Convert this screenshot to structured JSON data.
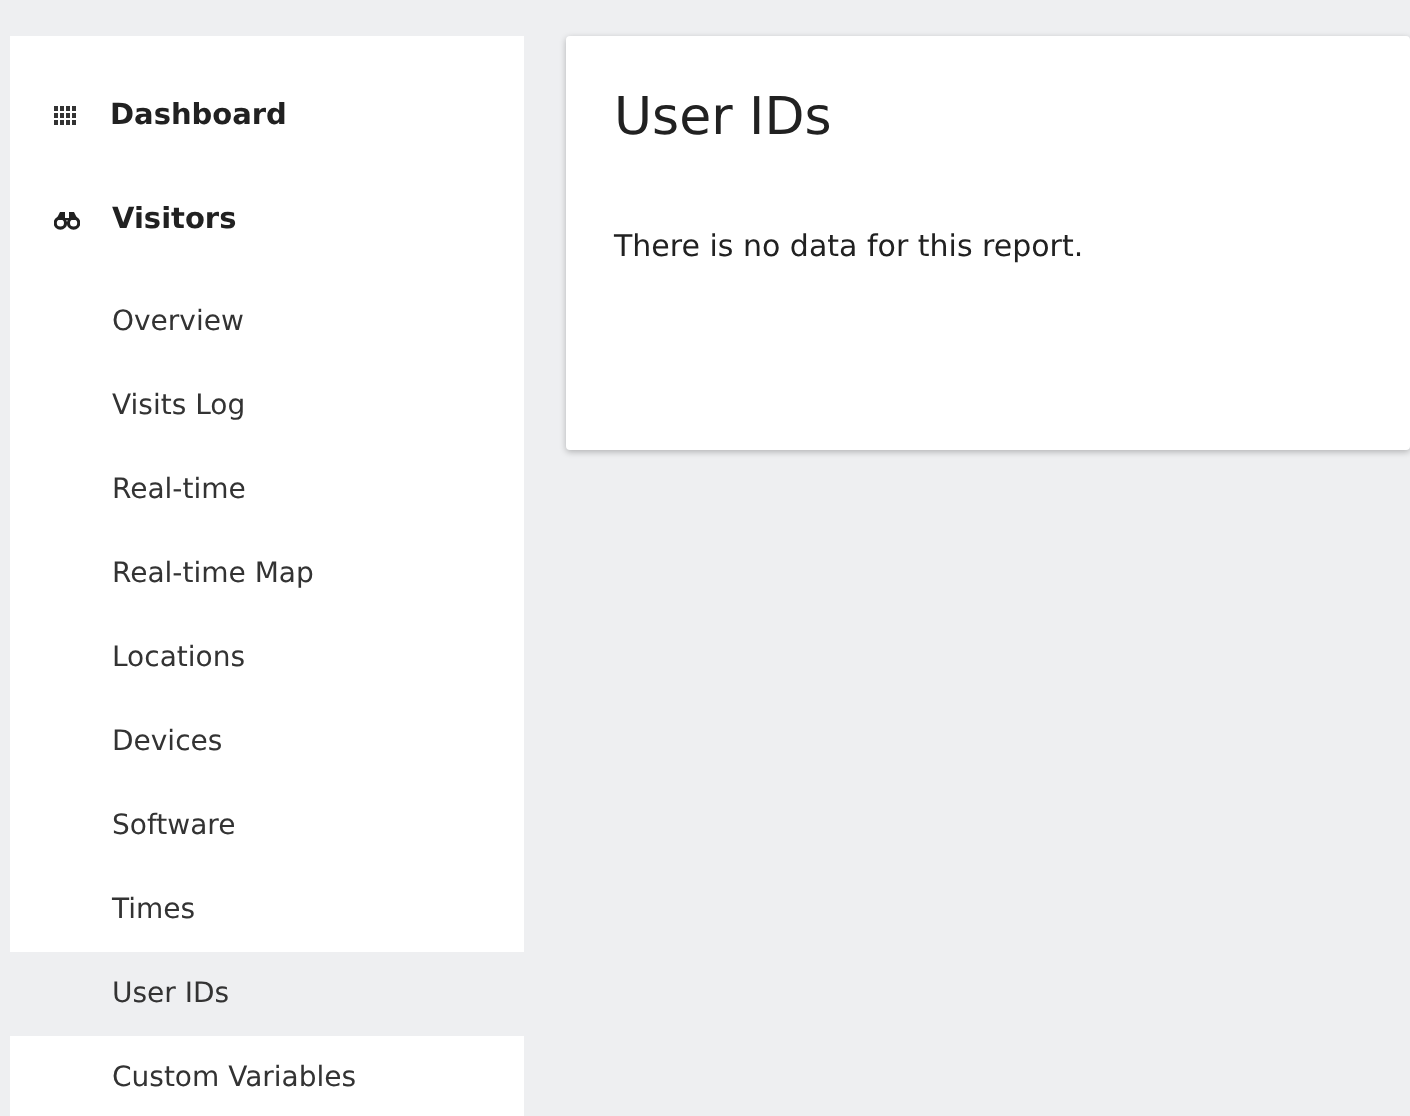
{
  "sidebar": {
    "sections": [
      {
        "label": "Dashboard"
      },
      {
        "label": "Visitors",
        "children": [
          {
            "label": "Overview",
            "selected": false
          },
          {
            "label": "Visits Log",
            "selected": false
          },
          {
            "label": "Real-time",
            "selected": false
          },
          {
            "label": "Real-time Map",
            "selected": false
          },
          {
            "label": "Locations",
            "selected": false
          },
          {
            "label": "Devices",
            "selected": false
          },
          {
            "label": "Software",
            "selected": false
          },
          {
            "label": "Times",
            "selected": false
          },
          {
            "label": "User IDs",
            "selected": true
          },
          {
            "label": "Custom Variables",
            "selected": false
          }
        ]
      }
    ]
  },
  "report": {
    "title": "User IDs",
    "message": "There is no data for this report."
  }
}
